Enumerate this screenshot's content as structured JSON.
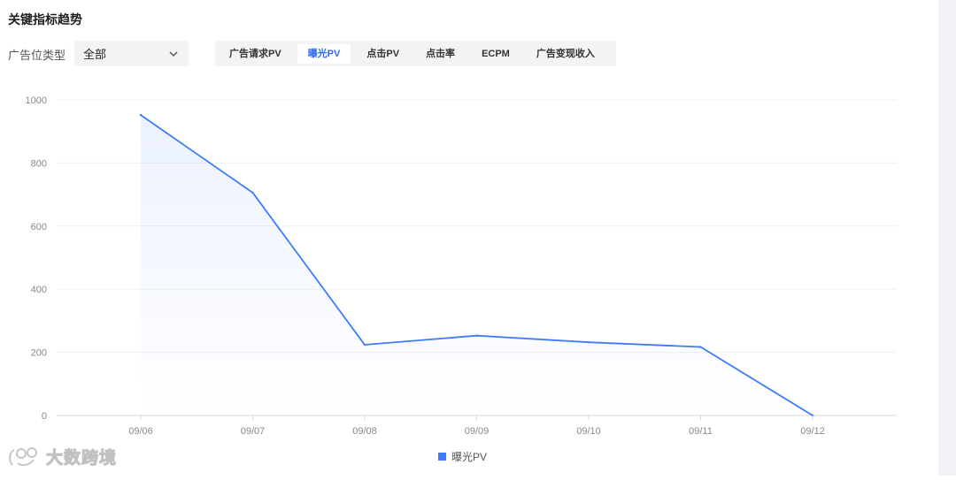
{
  "header": {
    "title": "关键指标趋势"
  },
  "filter": {
    "label": "广告位类型",
    "selected": "全部"
  },
  "tabs": [
    {
      "label": "广告请求PV",
      "active": false
    },
    {
      "label": "曝光PV",
      "active": true
    },
    {
      "label": "点击PV",
      "active": false
    },
    {
      "label": "点击率",
      "active": false
    },
    {
      "label": "ECPM",
      "active": false
    },
    {
      "label": "广告变现收入",
      "active": false
    }
  ],
  "watermark": {
    "text": "大数跨境"
  },
  "colors": {
    "accent": "#2f6ae8",
    "line": "#3e7bfa",
    "grid": "#f0f0f0"
  },
  "chart_data": {
    "type": "line",
    "categories": [
      "09/06",
      "09/07",
      "09/08",
      "09/09",
      "09/10",
      "09/11",
      "09/12"
    ],
    "series": [
      {
        "name": "曝光PV",
        "values": [
          952,
          706,
          224,
          253,
          232,
          217,
          0
        ]
      }
    ],
    "yticks": [
      "0",
      "200",
      "400",
      "600",
      "800",
      "1000"
    ],
    "ylim": [
      0,
      1000
    ],
    "grid": true,
    "legend": "bottom-center"
  }
}
